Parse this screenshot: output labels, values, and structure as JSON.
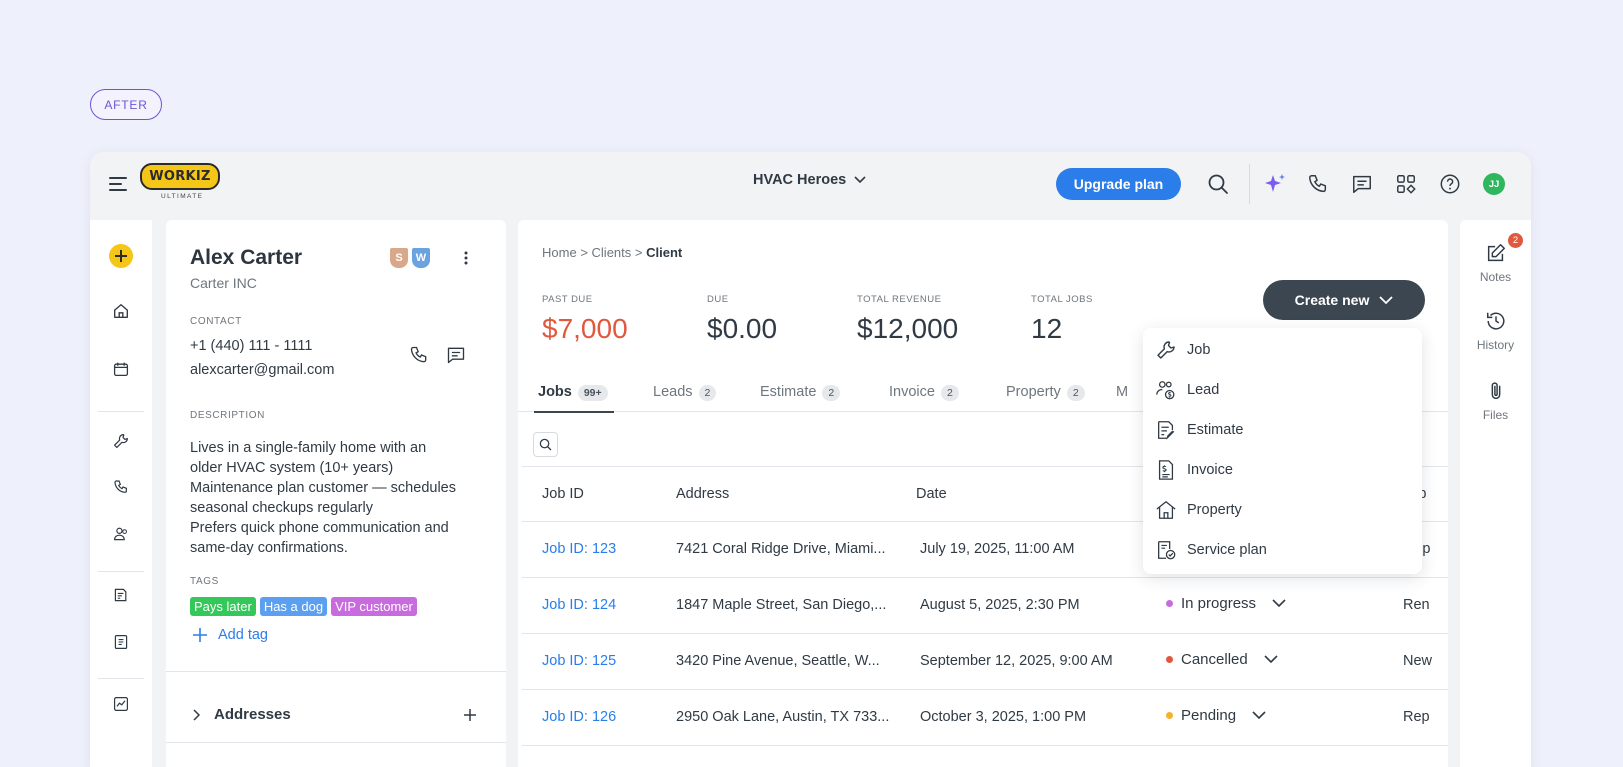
{
  "after_badge": "AFTER",
  "logo": {
    "text": "WORKIZ",
    "subtitle": "ULTIMATE"
  },
  "header": {
    "company": "HVAC Heroes",
    "upgrade_label": "Upgrade plan",
    "avatar_initials": "JJ"
  },
  "client": {
    "name": "Alex Carter",
    "badges": [
      "S",
      "W"
    ],
    "company": "Carter INC",
    "contact_label": "CONTACT",
    "phone": "+1 (440) 111 - 1111",
    "email": "alexcarter@gmail.com",
    "description_label": "DESCRIPTION",
    "description": [
      "Lives in a single-family home with an",
      "older HVAC system (10+ years)",
      "Maintenance plan customer — schedules",
      "seasonal checkups regularly",
      "Prefers quick phone communication and",
      "same-day confirmations."
    ],
    "tags_label": "TAGS",
    "tags": [
      {
        "label": "Pays later",
        "color": "#34c759"
      },
      {
        "label": "Has a dog",
        "color": "#5b9ff0"
      },
      {
        "label": "VIP customer",
        "color": "#c86bde"
      }
    ],
    "add_tag_label": "Add tag",
    "addresses_label": "Addresses"
  },
  "breadcrumb": {
    "home": "Home",
    "clients": "Clients",
    "current": "Client",
    "sep": ">"
  },
  "stats": [
    {
      "label": "PAST DUE",
      "value": "$7,000"
    },
    {
      "label": "DUE",
      "value": "$0.00"
    },
    {
      "label": "TOTAL REVENUE",
      "value": "$12,000"
    },
    {
      "label": "TOTAL JOBS",
      "value": "12"
    }
  ],
  "create_new_label": "Create new",
  "tabs": [
    {
      "label": "Jobs",
      "count": "99+"
    },
    {
      "label": "Leads",
      "count": "2"
    },
    {
      "label": "Estimate",
      "count": "2"
    },
    {
      "label": "Invoice",
      "count": "2"
    },
    {
      "label": "Property",
      "count": "2"
    }
  ],
  "tab_more": "M",
  "table": {
    "headers": [
      "Job ID",
      "Address",
      "Date",
      "Job"
    ],
    "rows": [
      {
        "id": "Job ID: 123",
        "address": "7421 Coral Ridge Drive, Miami...",
        "date": "July 19, 2025, 11:00 AM",
        "status": "",
        "status_color": "",
        "job": "Insp"
      },
      {
        "id": "Job ID: 124",
        "address": "1847 Maple Street, San Diego,...",
        "date": "August 5, 2025, 2:30 PM",
        "status": "In progress",
        "status_color": "#c86bde",
        "job": "Ren"
      },
      {
        "id": "Job ID: 125",
        "address": "3420 Pine Avenue, Seattle, W...",
        "date": "September 12, 2025, 9:00 AM",
        "status": "Cancelled",
        "status_color": "#e0583d",
        "job": "New"
      },
      {
        "id": "Job ID: 126",
        "address": "2950 Oak Lane, Austin, TX 733...",
        "date": "October 3, 2025, 1:00 PM",
        "status": "Pending",
        "status_color": "#f5b12e",
        "job": "Rep"
      }
    ]
  },
  "dropdown": [
    "Job",
    "Lead",
    "Estimate",
    "Invoice",
    "Property",
    "Service plan"
  ],
  "right_panel": {
    "notes": "Notes",
    "notes_count": "2",
    "history": "History",
    "files": "Files"
  },
  "colors": {
    "primary": "#2b7de9",
    "brand_yellow": "#f5c518",
    "dark_button": "#3c4650",
    "past_due": "#e0583d"
  }
}
